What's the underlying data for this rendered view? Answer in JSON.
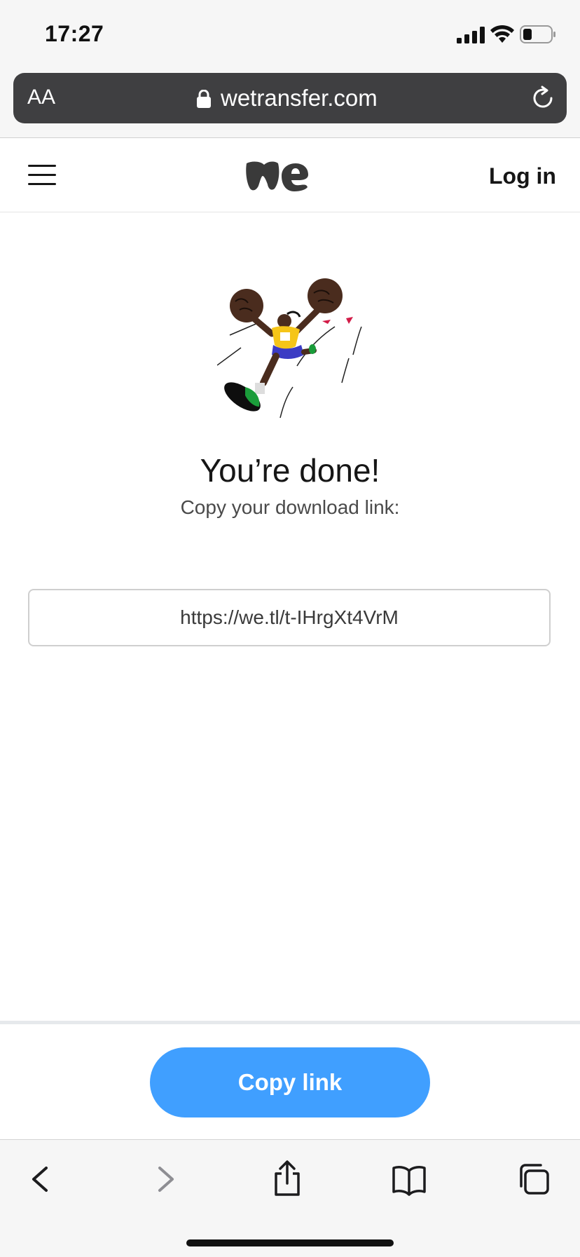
{
  "status_bar": {
    "time": "17:27",
    "icons": [
      "cellular-signal-icon",
      "wifi-icon",
      "battery-icon"
    ]
  },
  "browser": {
    "text_size_label": "AA",
    "domain": "wetransfer.com",
    "icons": [
      "lock-icon",
      "reload-icon"
    ]
  },
  "site_header": {
    "menu_icon": "hamburger-menu-icon",
    "logo": "We",
    "login_label": "Log in"
  },
  "main": {
    "illustration": "celebrating-runner-illustration",
    "title": "You’re done!",
    "subtitle": "Copy your download link:",
    "download_link": "https://we.tl/t-IHrgXt4VrM"
  },
  "actions": {
    "copy_label": "Copy link",
    "copy_color": "#409fff"
  },
  "toolbar": {
    "icons": [
      "back-icon",
      "forward-icon",
      "share-icon",
      "bookmarks-icon",
      "tabs-icon"
    ]
  }
}
